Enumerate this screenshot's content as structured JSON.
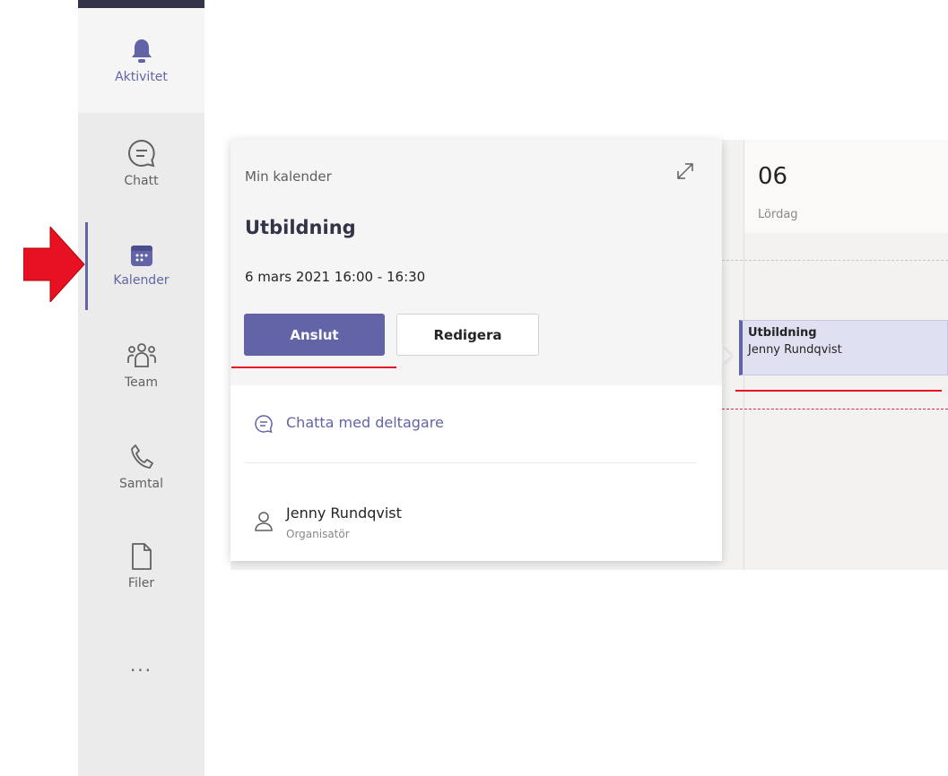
{
  "rail": {
    "items": [
      {
        "label": "Aktivitet",
        "icon": "bell-icon"
      },
      {
        "label": "Chatt",
        "icon": "chat-icon"
      },
      {
        "label": "Kalender",
        "icon": "calendar-icon"
      },
      {
        "label": "Team",
        "icon": "team-icon"
      },
      {
        "label": "Samtal",
        "icon": "phone-icon"
      },
      {
        "label": "Filer",
        "icon": "file-icon"
      }
    ],
    "more_label": "..."
  },
  "calendar": {
    "day_number": "06",
    "day_name": "Lördag"
  },
  "event": {
    "title": "Utbildning",
    "organizer": "Jenny Rundqvist"
  },
  "popup": {
    "calendar_name": "Min kalender",
    "title": "Utbildning",
    "datetime": "6 mars 2021 16:00 - 16:30",
    "join_label": "Anslut",
    "edit_label": "Redigera",
    "chat_label": "Chatta med deltagare",
    "organizer_name": "Jenny Rundqvist",
    "organizer_role": "Organisatör"
  },
  "colors": {
    "accent": "#6264a7",
    "annotation": "#e81123",
    "rail_bg": "#ebebeb"
  }
}
